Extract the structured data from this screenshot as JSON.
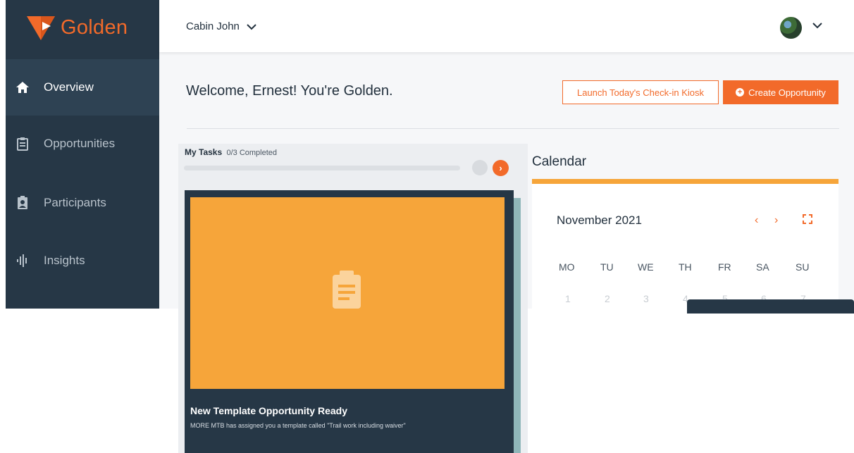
{
  "brand": {
    "name": "Golden",
    "color": "#f26a2a"
  },
  "sidebar": {
    "items": [
      {
        "label": "Overview",
        "icon": "home-icon",
        "active": true
      },
      {
        "label": "Opportunities",
        "icon": "clipboard-icon",
        "active": false
      },
      {
        "label": "Participants",
        "icon": "badge-icon",
        "active": false
      },
      {
        "label": "Insights",
        "icon": "waveform-icon",
        "active": false
      }
    ]
  },
  "header": {
    "location": "Cabin John",
    "avatar_icon": "user-avatar"
  },
  "main": {
    "welcome": "Welcome, Ernest! You're Golden.",
    "kiosk_button": "Launch Today's Check-in Kiosk",
    "create_button": "Create Opportunity"
  },
  "tasks": {
    "title": "My Tasks",
    "progress_text": "0/3 Completed",
    "progress_fraction": 0,
    "card": {
      "title": "New Template Opportunity Ready",
      "description": "MORE MTB has assigned you a template called \"Trail work including waiver\""
    }
  },
  "calendar": {
    "title": "Calendar",
    "month": "November 2021",
    "weekdays": [
      "MO",
      "TU",
      "WE",
      "TH",
      "FR",
      "SA",
      "SU"
    ],
    "days": [
      "1",
      "2",
      "3",
      "4",
      "5",
      "6",
      "7"
    ]
  },
  "colors": {
    "accent": "#f26a2a",
    "sidebar": "#263746",
    "card_image": "#f6a53a"
  }
}
